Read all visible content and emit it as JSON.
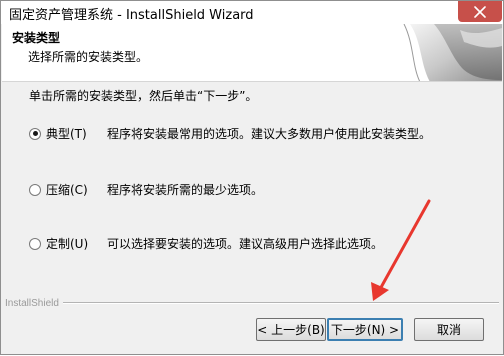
{
  "window": {
    "title": "固定资产管理系统 - InstallShield Wizard"
  },
  "header": {
    "title": "安装类型",
    "subtitle": "选择所需的安装类型。"
  },
  "instruction": "单击所需的安装类型，然后单击“下一步”。",
  "options": [
    {
      "label": "典型(T)",
      "description": "程序将安装最常用的选项。建议大多数用户使用此安装类型。",
      "selected": true
    },
    {
      "label": "压缩(C)",
      "description": "程序将安装所需的最少选项。",
      "selected": false
    },
    {
      "label": "定制(U)",
      "description": "可以选择要安装的选项。建议高级用户选择此选项。",
      "selected": false
    }
  ],
  "brand": "InstallShield",
  "buttons": {
    "back": "< 上一步(B)",
    "next": "下一步(N) >",
    "cancel": "取消"
  },
  "colors": {
    "close_button": "#c7504a",
    "annotation_arrow": "#e8372e",
    "default_button_border": "#3c7fb1"
  }
}
